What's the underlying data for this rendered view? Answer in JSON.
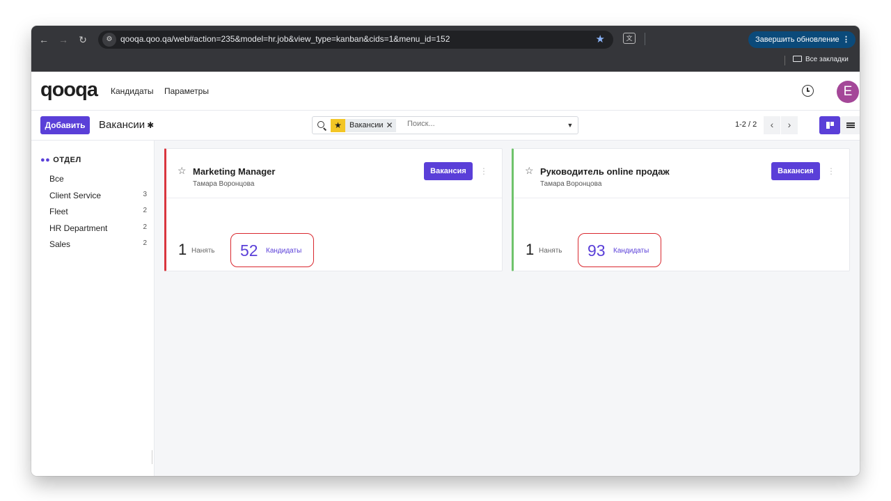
{
  "browser": {
    "url": "qooqa.qoo.qa/web#action=235&model=hr.job&view_type=kanban&cids=1&menu_id=152",
    "update_button": "Завершить обновление",
    "bookmarks_label": "Все закладки"
  },
  "app": {
    "logo": "qooqa",
    "menu": [
      "Кандидаты",
      "Параметры"
    ],
    "avatar_letter": "E",
    "avatar_color": "#a44798"
  },
  "control": {
    "add_button": "Добавить",
    "breadcrumb": "Вакансии",
    "facet_label": "Вакансии",
    "search_placeholder": "Поиск...",
    "pager": "1-2 / 2"
  },
  "sidebar": {
    "title": "ОТДЕЛ",
    "items": [
      {
        "label": "Все",
        "count": ""
      },
      {
        "label": "Client Service",
        "count": "3"
      },
      {
        "label": "Fleet",
        "count": "2"
      },
      {
        "label": "HR Department",
        "count": "2"
      },
      {
        "label": "Sales",
        "count": "2"
      }
    ]
  },
  "cards": [
    {
      "title": "Marketing Manager",
      "recruiter": "Тамара Воронцова",
      "badge": "Вакансия",
      "hire_count": "1",
      "hire_label": "Нанять",
      "candidates_count": "52",
      "candidates_label": "Кандидаты",
      "color": "#d9363e"
    },
    {
      "title": "Руководитель online продаж",
      "recruiter": "Тамара Воронцова",
      "badge": "Вакансия",
      "hire_count": "1",
      "hire_label": "Нанять",
      "candidates_count": "93",
      "candidates_label": "Кандидаты",
      "color": "#6fc36b"
    }
  ],
  "colors": {
    "accent": "#5a3fd8",
    "highlight_outline": "#d9272e",
    "facet_star": "#f3c625"
  }
}
